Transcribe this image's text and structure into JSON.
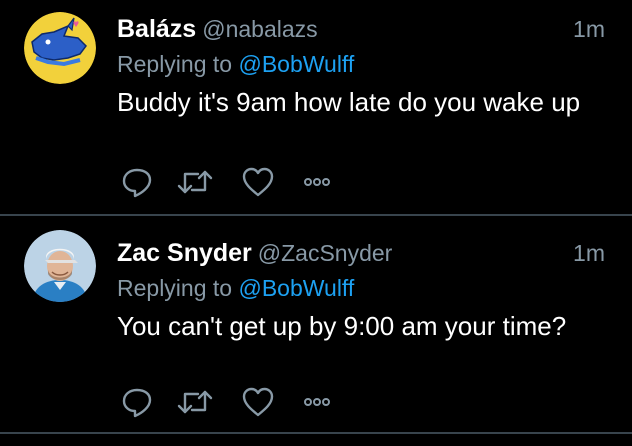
{
  "tweets": [
    {
      "display_name": "Balázs",
      "handle": "@nabalazs",
      "time": "1m",
      "replying_prefix": "Replying to",
      "replying_to": "@BobWulff",
      "text": "Buddy it's 9am how late do you wake up",
      "avatar_icon": "blue-rhino-avatar"
    },
    {
      "display_name": "Zac Snyder",
      "handle": "@ZacSnyder",
      "time": "1m",
      "replying_prefix": "Replying to",
      "replying_to": "@BobWulff",
      "text": "You can't get up by 9:00 am your time?",
      "avatar_icon": "man-white-cap-avatar"
    }
  ],
  "colors": {
    "background": "#000000",
    "primary_text": "#ffffff",
    "secondary_text": "#8899a6",
    "link": "#1da1f2",
    "divider": "#38444d"
  },
  "action_icons": [
    "reply-icon",
    "retweet-icon",
    "like-icon",
    "more-icon"
  ]
}
